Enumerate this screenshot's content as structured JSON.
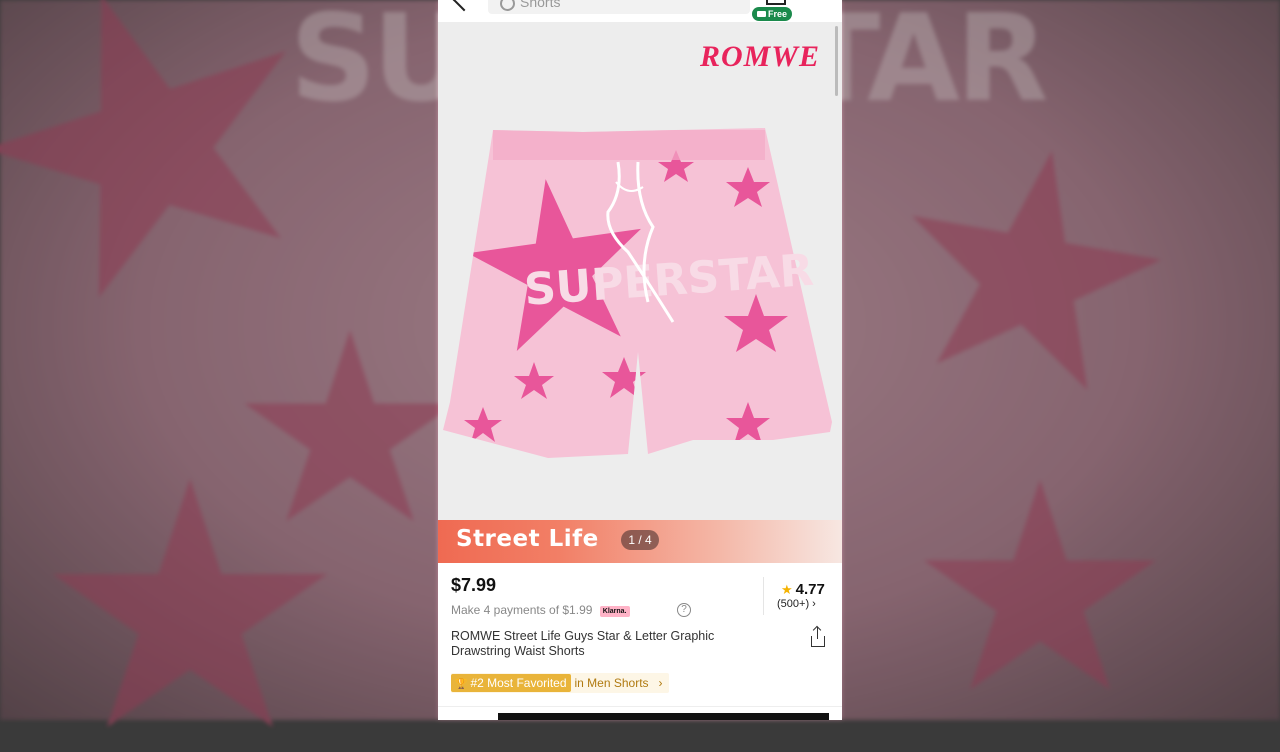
{
  "header": {
    "search_placeholder": "Shorts",
    "shipping_badge": "Free"
  },
  "gallery": {
    "brand": "ROMWE",
    "print_text": "SUPERSTAR",
    "promo_title": "Street Life",
    "page_counter": "1 / 4"
  },
  "product": {
    "price": "$7.99",
    "installments": "Make 4 payments of $1.99",
    "klarna": "Klarna.",
    "rating": "4.77",
    "review_count": "(500+)",
    "title": "ROMWE Street Life Guys Star & Letter Graphic Drawstring Waist Shorts",
    "ranking_tag": "#2 Most Favorited",
    "ranking_category": "in Men Shorts"
  },
  "colors": {
    "brand": "#e8245c",
    "star_pink": "#e8569a",
    "fabric_pink": "#f6c2d6",
    "ranking_gold": "#e9b43a",
    "free_green": "#1b8a4c"
  },
  "icons": [
    "back-icon",
    "search-icon",
    "cart-icon",
    "truck-icon",
    "help-icon",
    "star-icon",
    "chevron-right-icon",
    "share-icon",
    "trophy-icon"
  ]
}
